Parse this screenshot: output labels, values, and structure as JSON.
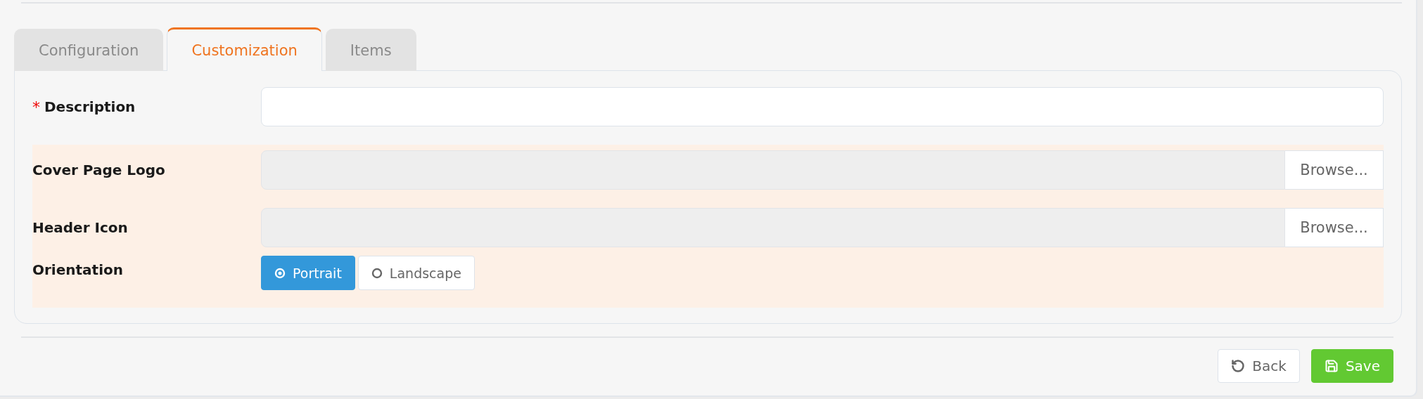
{
  "tabs": [
    {
      "label": "Configuration",
      "selected": false
    },
    {
      "label": "Customization",
      "selected": true
    },
    {
      "label": "Items",
      "selected": false
    }
  ],
  "form": {
    "description": {
      "required_mark": "*",
      "label": "Description"
    },
    "file_fields": [
      {
        "label": "Cover Page Logo",
        "button": "Browse..."
      },
      {
        "label": "Header Icon",
        "button": "Browse..."
      }
    ],
    "orientation": {
      "label": "Orientation",
      "options": [
        {
          "label": "Portrait",
          "selected": true
        },
        {
          "label": "Landscape",
          "selected": false
        }
      ]
    }
  },
  "actions": {
    "back": "Back",
    "save": "Save"
  }
}
